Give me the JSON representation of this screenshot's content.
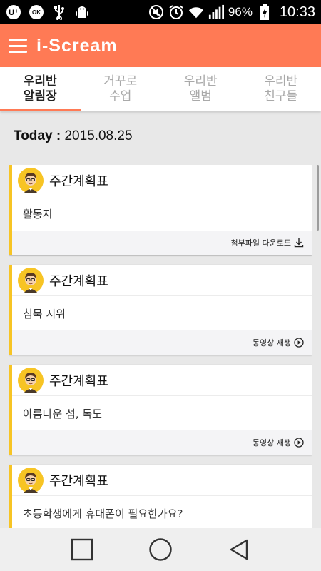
{
  "status_bar": {
    "battery_percent": "96%",
    "time": "10:33",
    "left_icons": [
      "u-plus-icon",
      "ok-cashbag-icon",
      "usb-icon",
      "android-debug-icon"
    ],
    "right_icons": [
      "mute-icon",
      "alarm-icon",
      "wifi-icon",
      "signal-icon",
      "battery-charging-icon"
    ]
  },
  "app_bar": {
    "title": "i-Scream",
    "menu_icon": "hamburger-menu-icon",
    "color": "#ff7a55"
  },
  "tabs": [
    {
      "line1": "우리반",
      "line2": "알림장",
      "active": true
    },
    {
      "line1": "거꾸로",
      "line2": "수업",
      "active": false
    },
    {
      "line1": "우리반",
      "line2": "앨범",
      "active": false
    },
    {
      "line1": "우리반",
      "line2": "친구들",
      "active": false
    }
  ],
  "today": {
    "label": "Today :",
    "date": "2015.08.25"
  },
  "cards": [
    {
      "title": "주간계획표",
      "content": "활동지",
      "action": "첨부파일 다운로드",
      "action_icon": "download-icon"
    },
    {
      "title": "주간계획표",
      "content": "침묵 시위",
      "action": "동영상 재생",
      "action_icon": "play-circle-icon"
    },
    {
      "title": "주간계획표",
      "content": "아름다운 섬, 독도",
      "action": "동영상 재생",
      "action_icon": "play-circle-icon"
    },
    {
      "title": "주간계획표",
      "content": "초등학생에게 휴대폰이 필요한가요?",
      "action": "",
      "action_icon": ""
    }
  ],
  "accent_colors": {
    "primary": "#ff7a55",
    "card_stripe": "#f7c424"
  },
  "nav_bar": {
    "buttons": [
      "recent-apps-icon",
      "home-icon",
      "back-icon"
    ]
  }
}
